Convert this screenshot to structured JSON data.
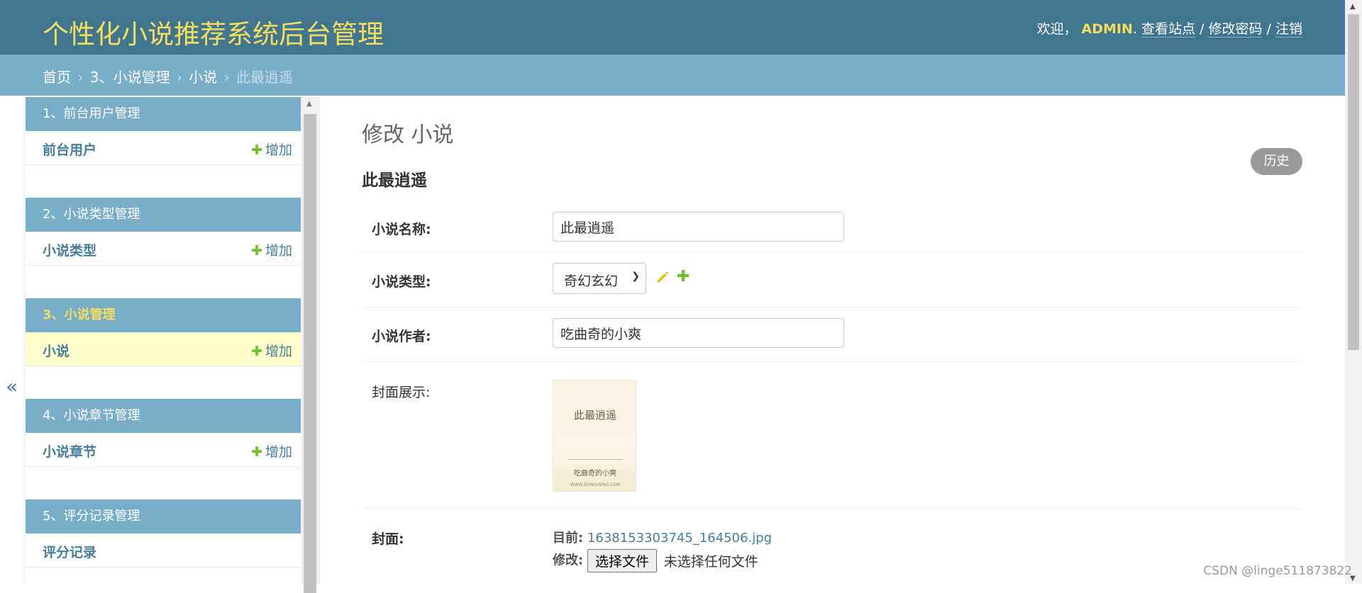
{
  "header": {
    "site_name": "个性化小说推荐系统后台管理",
    "welcome": "欢迎，",
    "username": "ADMIN",
    "view_site": "查看站点",
    "change_password": "修改密码",
    "logout": "注销",
    "separator": "/"
  },
  "breadcrumbs": {
    "home": "首页",
    "app": "3、小说管理",
    "model": "小说",
    "current": "此最逍遥",
    "sep": "›"
  },
  "sidebar": {
    "collapse": "«",
    "add_label": "增加",
    "modules": [
      {
        "caption": "1、前台用户管理",
        "model": "前台用户"
      },
      {
        "caption": "2、小说类型管理",
        "model": "小说类型"
      },
      {
        "caption": "3、小说管理",
        "model": "小说"
      },
      {
        "caption": "4、小说章节管理",
        "model": "小说章节"
      },
      {
        "caption": "5、评分记录管理",
        "model": "评分记录"
      }
    ]
  },
  "main": {
    "title": "修改 小说",
    "history": "历史",
    "object_name": "此最逍遥",
    "fields": {
      "name": {
        "label": "小说名称:",
        "value": "此最逍遥"
      },
      "type": {
        "label": "小说类型:",
        "value": "奇幻玄幻"
      },
      "author": {
        "label": "小说作者:",
        "value": "吃曲奇的小爽"
      },
      "cover_display": {
        "label": "封面展示:"
      },
      "cover": {
        "label": "封面:",
        "current_label": "目前:",
        "current_file": "1638153303745_164506.jpg",
        "change_label": "修改:",
        "choose_button": "选择文件",
        "no_file": "未选择任何文件"
      }
    },
    "cover_image": {
      "title": "此最逍遥",
      "author": "吃曲奇的小爽",
      "site": "WWW.ZONGHENG.COM"
    }
  },
  "watermark": "CSDN @linge511873822",
  "colors": {
    "header_bg": "#417690",
    "breadcrumb_bg": "#79aec8",
    "accent_yellow": "#f5dd5d",
    "link_blue": "#447e9b",
    "add_green": "#70bf2b",
    "active_row": "#ffffcc"
  }
}
